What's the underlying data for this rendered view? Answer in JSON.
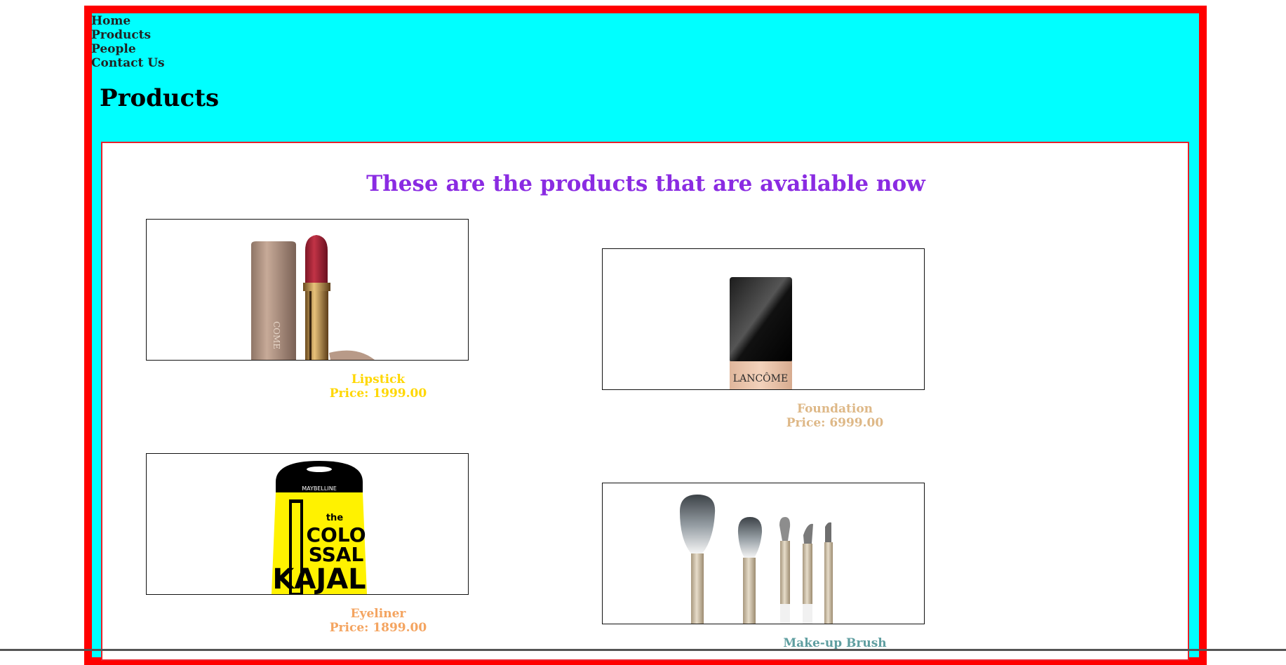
{
  "nav": {
    "items": [
      "Home",
      "Products",
      "People",
      "Contact Us"
    ]
  },
  "page": {
    "title": "Products",
    "headline": "These are the products that are available now"
  },
  "products": [
    {
      "name": "Lipstick",
      "price": "Price: 1999.00",
      "color": "#ffd700",
      "image": "lipstick-image",
      "brand_text": "LANCOME"
    },
    {
      "name": "Foundation",
      "price": "Price: 6999.00",
      "color": "#deb887",
      "image": "foundation-image",
      "brand_text": "LANCÔME"
    },
    {
      "name": "Eyeliner",
      "price": "Price: 1899.00",
      "color": "#f4a460",
      "image": "kajal-image",
      "brand_text": "MAYBELLINE",
      "product_text": "the COLOSSAL KAJAL"
    },
    {
      "name": "Make-up Brush",
      "price": "",
      "color": "#5f9ea0",
      "image": "brush-set-image"
    }
  ],
  "colors": {
    "outer_border": "#ff0000",
    "page_background": "#00ffff",
    "inner_border": "#e8202a",
    "headline": "#8a2be2"
  }
}
